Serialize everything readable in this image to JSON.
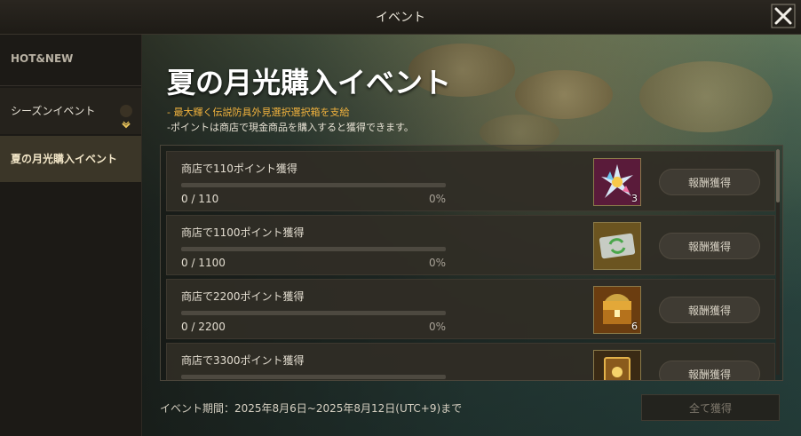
{
  "window": {
    "title": "イベント"
  },
  "sidebar": {
    "hot_label": "HOT&NEW",
    "season_label": "シーズンイベント",
    "event_label": "夏の月光購入イベント"
  },
  "event": {
    "title": "夏の月光購入イベント",
    "desc_highlight": "- 最大輝く伝説防具外見選択選択箱を支給",
    "desc_note": "-ポイントは商店で現金商品を購入すると獲得できます。"
  },
  "rows": [
    {
      "label": "商店で110ポイント獲得",
      "progress": "0 / 110",
      "percent": "0%",
      "fraction": 0,
      "item": "crystal-cluster-icon",
      "qty": "3",
      "button": "報酬獲得"
    },
    {
      "label": "商店で1100ポイント獲得",
      "progress": "0 / 1100",
      "percent": "0%",
      "fraction": 0,
      "item": "exchange-ticket-icon",
      "qty": "",
      "button": "報酬獲得"
    },
    {
      "label": "商店で2200ポイント獲得",
      "progress": "0 / 2200",
      "percent": "0%",
      "fraction": 0,
      "item": "treasure-chest-icon",
      "qty": "6",
      "button": "報酬獲得"
    },
    {
      "label": "商店で3300ポイント獲得",
      "progress": "",
      "percent": "",
      "fraction": 0,
      "item": "card-icon",
      "qty": "",
      "button": "報酬獲得"
    }
  ],
  "footer": {
    "period": "イベント期間：2025年8月6日~2025年8月12日(UTC+9)まで",
    "claim_all": "全て獲得"
  },
  "colors": {
    "accent_gold": "#d9b35a",
    "highlight_orange": "#f1b23d"
  }
}
